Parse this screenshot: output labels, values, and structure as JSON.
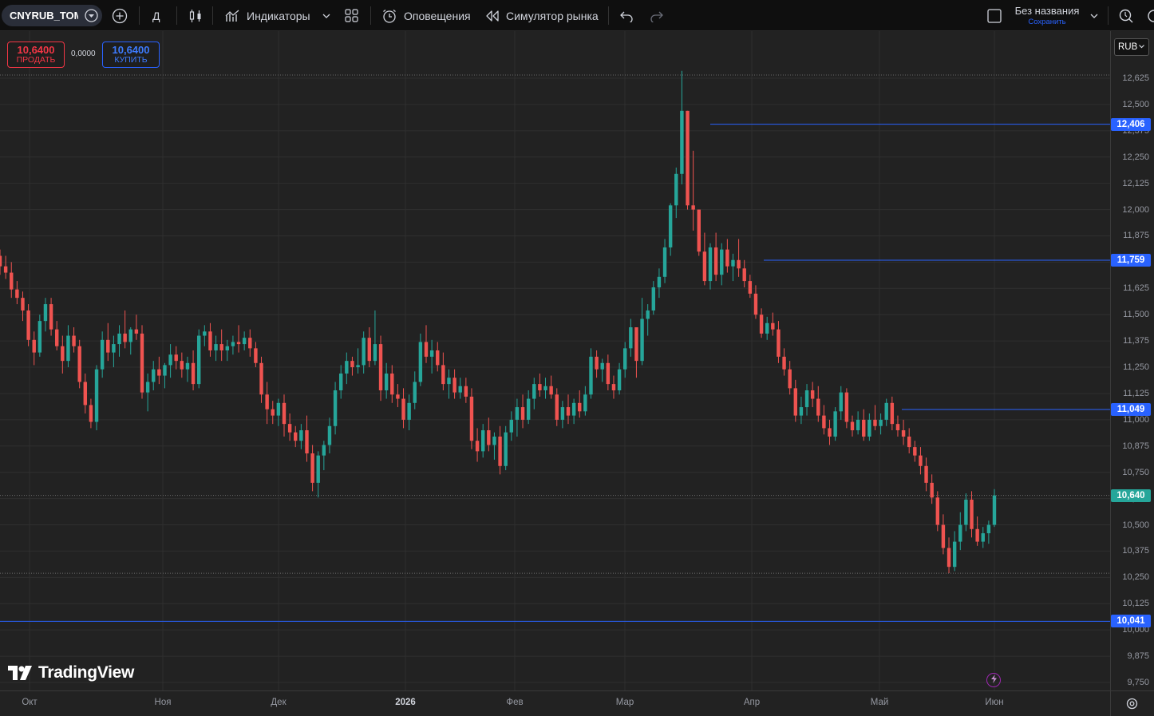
{
  "toolbar": {
    "symbol": "CNYRUB_TOM",
    "interval": "Д",
    "indicators": "Индикаторы",
    "alerts": "Оповещения",
    "replay": "Симулятор рынка",
    "layout_name": "Без названия",
    "layout_save": "Сохранить"
  },
  "trade": {
    "sell_price": "10,6400",
    "sell_label": "ПРОДАТЬ",
    "spread": "0,0000",
    "buy_price": "10,6400",
    "buy_label": "КУПИТЬ"
  },
  "currency": "RUB",
  "brand": "TradingView",
  "colors": {
    "up": "#26a69a",
    "down": "#ef5350",
    "line": "#2962ff",
    "background": "#222222"
  },
  "price_axis": {
    "ticks": [
      "12,625",
      "12,500",
      "12,375",
      "12,250",
      "12,125",
      "12,000",
      "11,875",
      "11,750",
      "11,625",
      "11,500",
      "11,375",
      "11,250",
      "11,125",
      "11,000",
      "10,875",
      "10,750",
      "10,625",
      "10,500",
      "10,375",
      "10,250",
      "10,125",
      "10,000",
      "9,875",
      "9,750"
    ],
    "labels": {
      "l1": "12,406",
      "l2": "11,759",
      "l3": "11,049",
      "last": "10,640",
      "l4": "10,041"
    }
  },
  "time_axis": [
    "Окт",
    "Ноя",
    "Дек",
    "2026",
    "Фев",
    "Мар",
    "Апр",
    "Май",
    "Июн"
  ],
  "chart_data": {
    "type": "candlestick",
    "symbol": "CNYRUB_TOM",
    "interval": "Д",
    "ylim": [
      9.72,
      12.75
    ],
    "last_price": 10.64,
    "horizontal_lines": [
      12.406,
      11.759,
      11.049,
      10.041
    ],
    "months": [
      "Окт",
      "Ноя",
      "Дек",
      "2026",
      "Фев",
      "Мар",
      "Апр",
      "Май",
      "Июн"
    ],
    "candles": [
      [
        11.78,
        11.81,
        11.69,
        11.73
      ],
      [
        11.73,
        11.78,
        11.67,
        11.7
      ],
      [
        11.7,
        11.75,
        11.58,
        11.62
      ],
      [
        11.62,
        11.66,
        11.55,
        11.58
      ],
      [
        11.58,
        11.61,
        11.47,
        11.52
      ],
      [
        11.52,
        11.55,
        11.35,
        11.38
      ],
      [
        11.38,
        11.42,
        11.26,
        11.32
      ],
      [
        11.32,
        11.5,
        11.3,
        11.47
      ],
      [
        11.47,
        11.58,
        11.42,
        11.55
      ],
      [
        11.55,
        11.58,
        11.4,
        11.43
      ],
      [
        11.43,
        11.47,
        11.33,
        11.35
      ],
      [
        11.35,
        11.4,
        11.22,
        11.28
      ],
      [
        11.28,
        11.45,
        11.25,
        11.4
      ],
      [
        11.4,
        11.44,
        11.32,
        11.35
      ],
      [
        11.35,
        11.38,
        11.15,
        11.18
      ],
      [
        11.18,
        11.22,
        11.03,
        11.07
      ],
      [
        11.07,
        11.1,
        10.96,
        10.99
      ],
      [
        10.99,
        11.26,
        10.95,
        11.24
      ],
      [
        11.24,
        11.42,
        11.2,
        11.38
      ],
      [
        11.38,
        11.46,
        11.28,
        11.32
      ],
      [
        11.32,
        11.4,
        11.25,
        11.36
      ],
      [
        11.36,
        11.45,
        11.3,
        11.41
      ],
      [
        11.41,
        11.52,
        11.34,
        11.37
      ],
      [
        11.37,
        11.44,
        11.31,
        11.43
      ],
      [
        11.43,
        11.5,
        11.38,
        11.41
      ],
      [
        11.41,
        11.45,
        11.1,
        11.13
      ],
      [
        11.13,
        11.22,
        11.04,
        11.18
      ],
      [
        11.18,
        11.28,
        11.14,
        11.24
      ],
      [
        11.24,
        11.3,
        11.17,
        11.21
      ],
      [
        11.21,
        11.27,
        11.15,
        11.26
      ],
      [
        11.26,
        11.36,
        11.2,
        11.31
      ],
      [
        11.31,
        11.35,
        11.24,
        11.28
      ],
      [
        11.28,
        11.32,
        11.2,
        11.24
      ],
      [
        11.24,
        11.3,
        11.18,
        11.27
      ],
      [
        11.27,
        11.33,
        11.14,
        11.17
      ],
      [
        11.17,
        11.43,
        11.15,
        11.4
      ],
      [
        11.4,
        11.45,
        11.35,
        11.42
      ],
      [
        11.42,
        11.46,
        11.3,
        11.33
      ],
      [
        11.33,
        11.4,
        11.28,
        11.36
      ],
      [
        11.36,
        11.43,
        11.28,
        11.33
      ],
      [
        11.33,
        11.38,
        11.28,
        11.35
      ],
      [
        11.35,
        11.4,
        11.31,
        11.37
      ],
      [
        11.37,
        11.45,
        11.32,
        11.36
      ],
      [
        11.36,
        11.42,
        11.33,
        11.39
      ],
      [
        11.39,
        11.43,
        11.3,
        11.34
      ],
      [
        11.34,
        11.37,
        11.25,
        11.27
      ],
      [
        11.27,
        11.3,
        11.08,
        11.12
      ],
      [
        11.12,
        11.18,
        10.98,
        11.05
      ],
      [
        11.05,
        11.09,
        10.98,
        11.02
      ],
      [
        11.02,
        11.1,
        10.97,
        11.08
      ],
      [
        11.08,
        11.12,
        10.92,
        10.98
      ],
      [
        10.98,
        11.03,
        10.9,
        10.94
      ],
      [
        10.94,
        10.97,
        10.87,
        10.9
      ],
      [
        10.9,
        10.98,
        10.86,
        10.95
      ],
      [
        10.95,
        11.02,
        10.8,
        10.84
      ],
      [
        10.84,
        10.88,
        10.66,
        10.7
      ],
      [
        10.7,
        10.85,
        10.63,
        10.83
      ],
      [
        10.83,
        10.9,
        10.76,
        10.88
      ],
      [
        10.88,
        11.01,
        10.84,
        10.97
      ],
      [
        10.97,
        11.18,
        10.93,
        11.14
      ],
      [
        11.14,
        11.26,
        11.1,
        11.22
      ],
      [
        11.22,
        11.32,
        11.17,
        11.28
      ],
      [
        11.28,
        11.3,
        11.21,
        11.25
      ],
      [
        11.25,
        11.34,
        11.22,
        11.26
      ],
      [
        11.26,
        11.42,
        11.22,
        11.39
      ],
      [
        11.39,
        11.44,
        11.25,
        11.28
      ],
      [
        11.28,
        11.52,
        11.26,
        11.36
      ],
      [
        11.36,
        11.4,
        11.09,
        11.14
      ],
      [
        11.14,
        11.27,
        11.1,
        11.22
      ],
      [
        11.22,
        11.26,
        11.08,
        11.12
      ],
      [
        11.12,
        11.17,
        11.06,
        11.1
      ],
      [
        11.1,
        11.15,
        10.96,
        11.0
      ],
      [
        11.0,
        11.12,
        10.95,
        11.08
      ],
      [
        11.08,
        11.23,
        11.05,
        11.18
      ],
      [
        11.18,
        11.41,
        11.16,
        11.37
      ],
      [
        11.37,
        11.45,
        11.27,
        11.3
      ],
      [
        11.3,
        11.38,
        11.22,
        11.33
      ],
      [
        11.33,
        11.37,
        11.23,
        11.26
      ],
      [
        11.26,
        11.32,
        11.14,
        11.17
      ],
      [
        11.17,
        11.24,
        11.1,
        11.2
      ],
      [
        11.2,
        11.24,
        11.1,
        11.13
      ],
      [
        11.13,
        11.2,
        11.1,
        11.16
      ],
      [
        11.16,
        11.2,
        11.08,
        11.11
      ],
      [
        11.11,
        11.15,
        10.86,
        10.9
      ],
      [
        10.9,
        10.96,
        10.8,
        10.85
      ],
      [
        10.85,
        10.98,
        10.82,
        10.95
      ],
      [
        10.95,
        11.01,
        10.85,
        10.88
      ],
      [
        10.88,
        10.94,
        10.81,
        10.92
      ],
      [
        10.92,
        10.97,
        10.74,
        10.78
      ],
      [
        10.78,
        10.97,
        10.76,
        10.94
      ],
      [
        10.94,
        11.04,
        10.9,
        11.0
      ],
      [
        11.0,
        11.1,
        10.92,
        11.06
      ],
      [
        11.06,
        11.12,
        10.96,
        11.0
      ],
      [
        11.0,
        11.14,
        10.98,
        11.1
      ],
      [
        11.1,
        11.2,
        11.05,
        11.17
      ],
      [
        11.17,
        11.22,
        11.11,
        11.14
      ],
      [
        11.14,
        11.2,
        11.1,
        11.16
      ],
      [
        11.16,
        11.21,
        11.1,
        11.12
      ],
      [
        11.12,
        11.15,
        10.97,
        11.0
      ],
      [
        11.0,
        11.09,
        10.96,
        11.06
      ],
      [
        11.06,
        11.12,
        10.98,
        11.02
      ],
      [
        11.02,
        11.1,
        10.98,
        11.08
      ],
      [
        11.08,
        11.14,
        11.01,
        11.04
      ],
      [
        11.04,
        11.16,
        11.02,
        11.12
      ],
      [
        11.12,
        11.34,
        11.1,
        11.3
      ],
      [
        11.3,
        11.33,
        11.2,
        11.24
      ],
      [
        11.24,
        11.29,
        11.18,
        11.27
      ],
      [
        11.27,
        11.31,
        11.14,
        11.17
      ],
      [
        11.17,
        11.21,
        11.1,
        11.14
      ],
      [
        11.14,
        11.27,
        11.12,
        11.24
      ],
      [
        11.24,
        11.37,
        11.2,
        11.34
      ],
      [
        11.34,
        11.48,
        11.3,
        11.44
      ],
      [
        11.44,
        11.36,
        11.2,
        11.28
      ],
      [
        11.28,
        11.58,
        11.26,
        11.48
      ],
      [
        11.48,
        11.55,
        11.4,
        11.52
      ],
      [
        11.52,
        11.66,
        11.5,
        11.63
      ],
      [
        11.63,
        11.72,
        11.58,
        11.68
      ],
      [
        11.68,
        11.86,
        11.65,
        11.82
      ],
      [
        11.82,
        12.03,
        11.78,
        12.02
      ],
      [
        12.02,
        12.2,
        11.96,
        12.17
      ],
      [
        12.17,
        12.66,
        12.12,
        12.47
      ],
      [
        12.47,
        12.42,
        12.0,
        12.02
      ],
      [
        12.02,
        12.28,
        11.9,
        12.0
      ],
      [
        12.0,
        11.95,
        11.78,
        11.8
      ],
      [
        11.8,
        11.89,
        11.64,
        11.66
      ],
      [
        11.66,
        11.84,
        11.62,
        11.82
      ],
      [
        11.82,
        11.89,
        11.66,
        11.69
      ],
      [
        11.69,
        11.84,
        11.64,
        11.81
      ],
      [
        11.81,
        11.86,
        11.7,
        11.73
      ],
      [
        11.73,
        11.79,
        11.66,
        11.76
      ],
      [
        11.76,
        11.86,
        11.68,
        11.72
      ],
      [
        11.72,
        11.76,
        11.63,
        11.66
      ],
      [
        11.66,
        11.69,
        11.58,
        11.6
      ],
      [
        11.6,
        11.64,
        11.48,
        11.5
      ],
      [
        11.5,
        11.53,
        11.39,
        11.41
      ],
      [
        11.41,
        11.49,
        11.38,
        11.46
      ],
      [
        11.46,
        11.51,
        11.4,
        11.43
      ],
      [
        11.43,
        11.47,
        11.27,
        11.3
      ],
      [
        11.3,
        11.34,
        11.21,
        11.24
      ],
      [
        11.24,
        11.28,
        11.12,
        11.15
      ],
      [
        11.15,
        11.19,
        10.99,
        11.02
      ],
      [
        11.02,
        11.11,
        10.98,
        11.06
      ],
      [
        11.06,
        11.17,
        11.02,
        11.14
      ],
      [
        11.14,
        11.18,
        11.06,
        11.1
      ],
      [
        11.1,
        11.16,
        10.99,
        11.02
      ],
      [
        11.02,
        11.07,
        10.93,
        10.96
      ],
      [
        10.96,
        11.0,
        10.88,
        10.92
      ],
      [
        10.92,
        11.06,
        10.9,
        11.04
      ],
      [
        11.04,
        11.16,
        11.0,
        11.13
      ],
      [
        11.13,
        11.15,
        10.96,
        10.99
      ],
      [
        10.99,
        11.02,
        10.92,
        10.95
      ],
      [
        10.95,
        11.04,
        10.93,
        11.0
      ],
      [
        11.0,
        11.05,
        10.9,
        10.92
      ],
      [
        10.92,
        11.03,
        10.9,
        11.0
      ],
      [
        11.0,
        11.07,
        10.95,
        10.97
      ],
      [
        10.97,
        11.03,
        10.93,
        11.0
      ],
      [
        11.0,
        11.1,
        10.97,
        11.08
      ],
      [
        11.08,
        11.11,
        10.95,
        10.98
      ],
      [
        10.98,
        11.02,
        10.92,
        10.95
      ],
      [
        10.95,
        11.0,
        10.88,
        10.92
      ],
      [
        10.92,
        10.96,
        10.84,
        10.87
      ],
      [
        10.87,
        10.9,
        10.8,
        10.83
      ],
      [
        10.83,
        10.87,
        10.74,
        10.78
      ],
      [
        10.78,
        10.82,
        10.66,
        10.7
      ],
      [
        10.7,
        10.74,
        10.6,
        10.63
      ],
      [
        10.63,
        10.66,
        10.47,
        10.5
      ],
      [
        10.5,
        10.55,
        10.36,
        10.39
      ],
      [
        10.39,
        10.44,
        10.27,
        10.3
      ],
      [
        10.3,
        10.47,
        10.28,
        10.42
      ],
      [
        10.42,
        10.56,
        10.38,
        10.5
      ],
      [
        10.5,
        10.65,
        10.47,
        10.62
      ],
      [
        10.62,
        10.66,
        10.44,
        10.48
      ],
      [
        10.48,
        10.54,
        10.4,
        10.42
      ],
      [
        10.42,
        10.49,
        10.39,
        10.46
      ],
      [
        10.46,
        10.52,
        10.41,
        10.5
      ],
      [
        10.5,
        10.67,
        10.49,
        10.64
      ]
    ]
  }
}
